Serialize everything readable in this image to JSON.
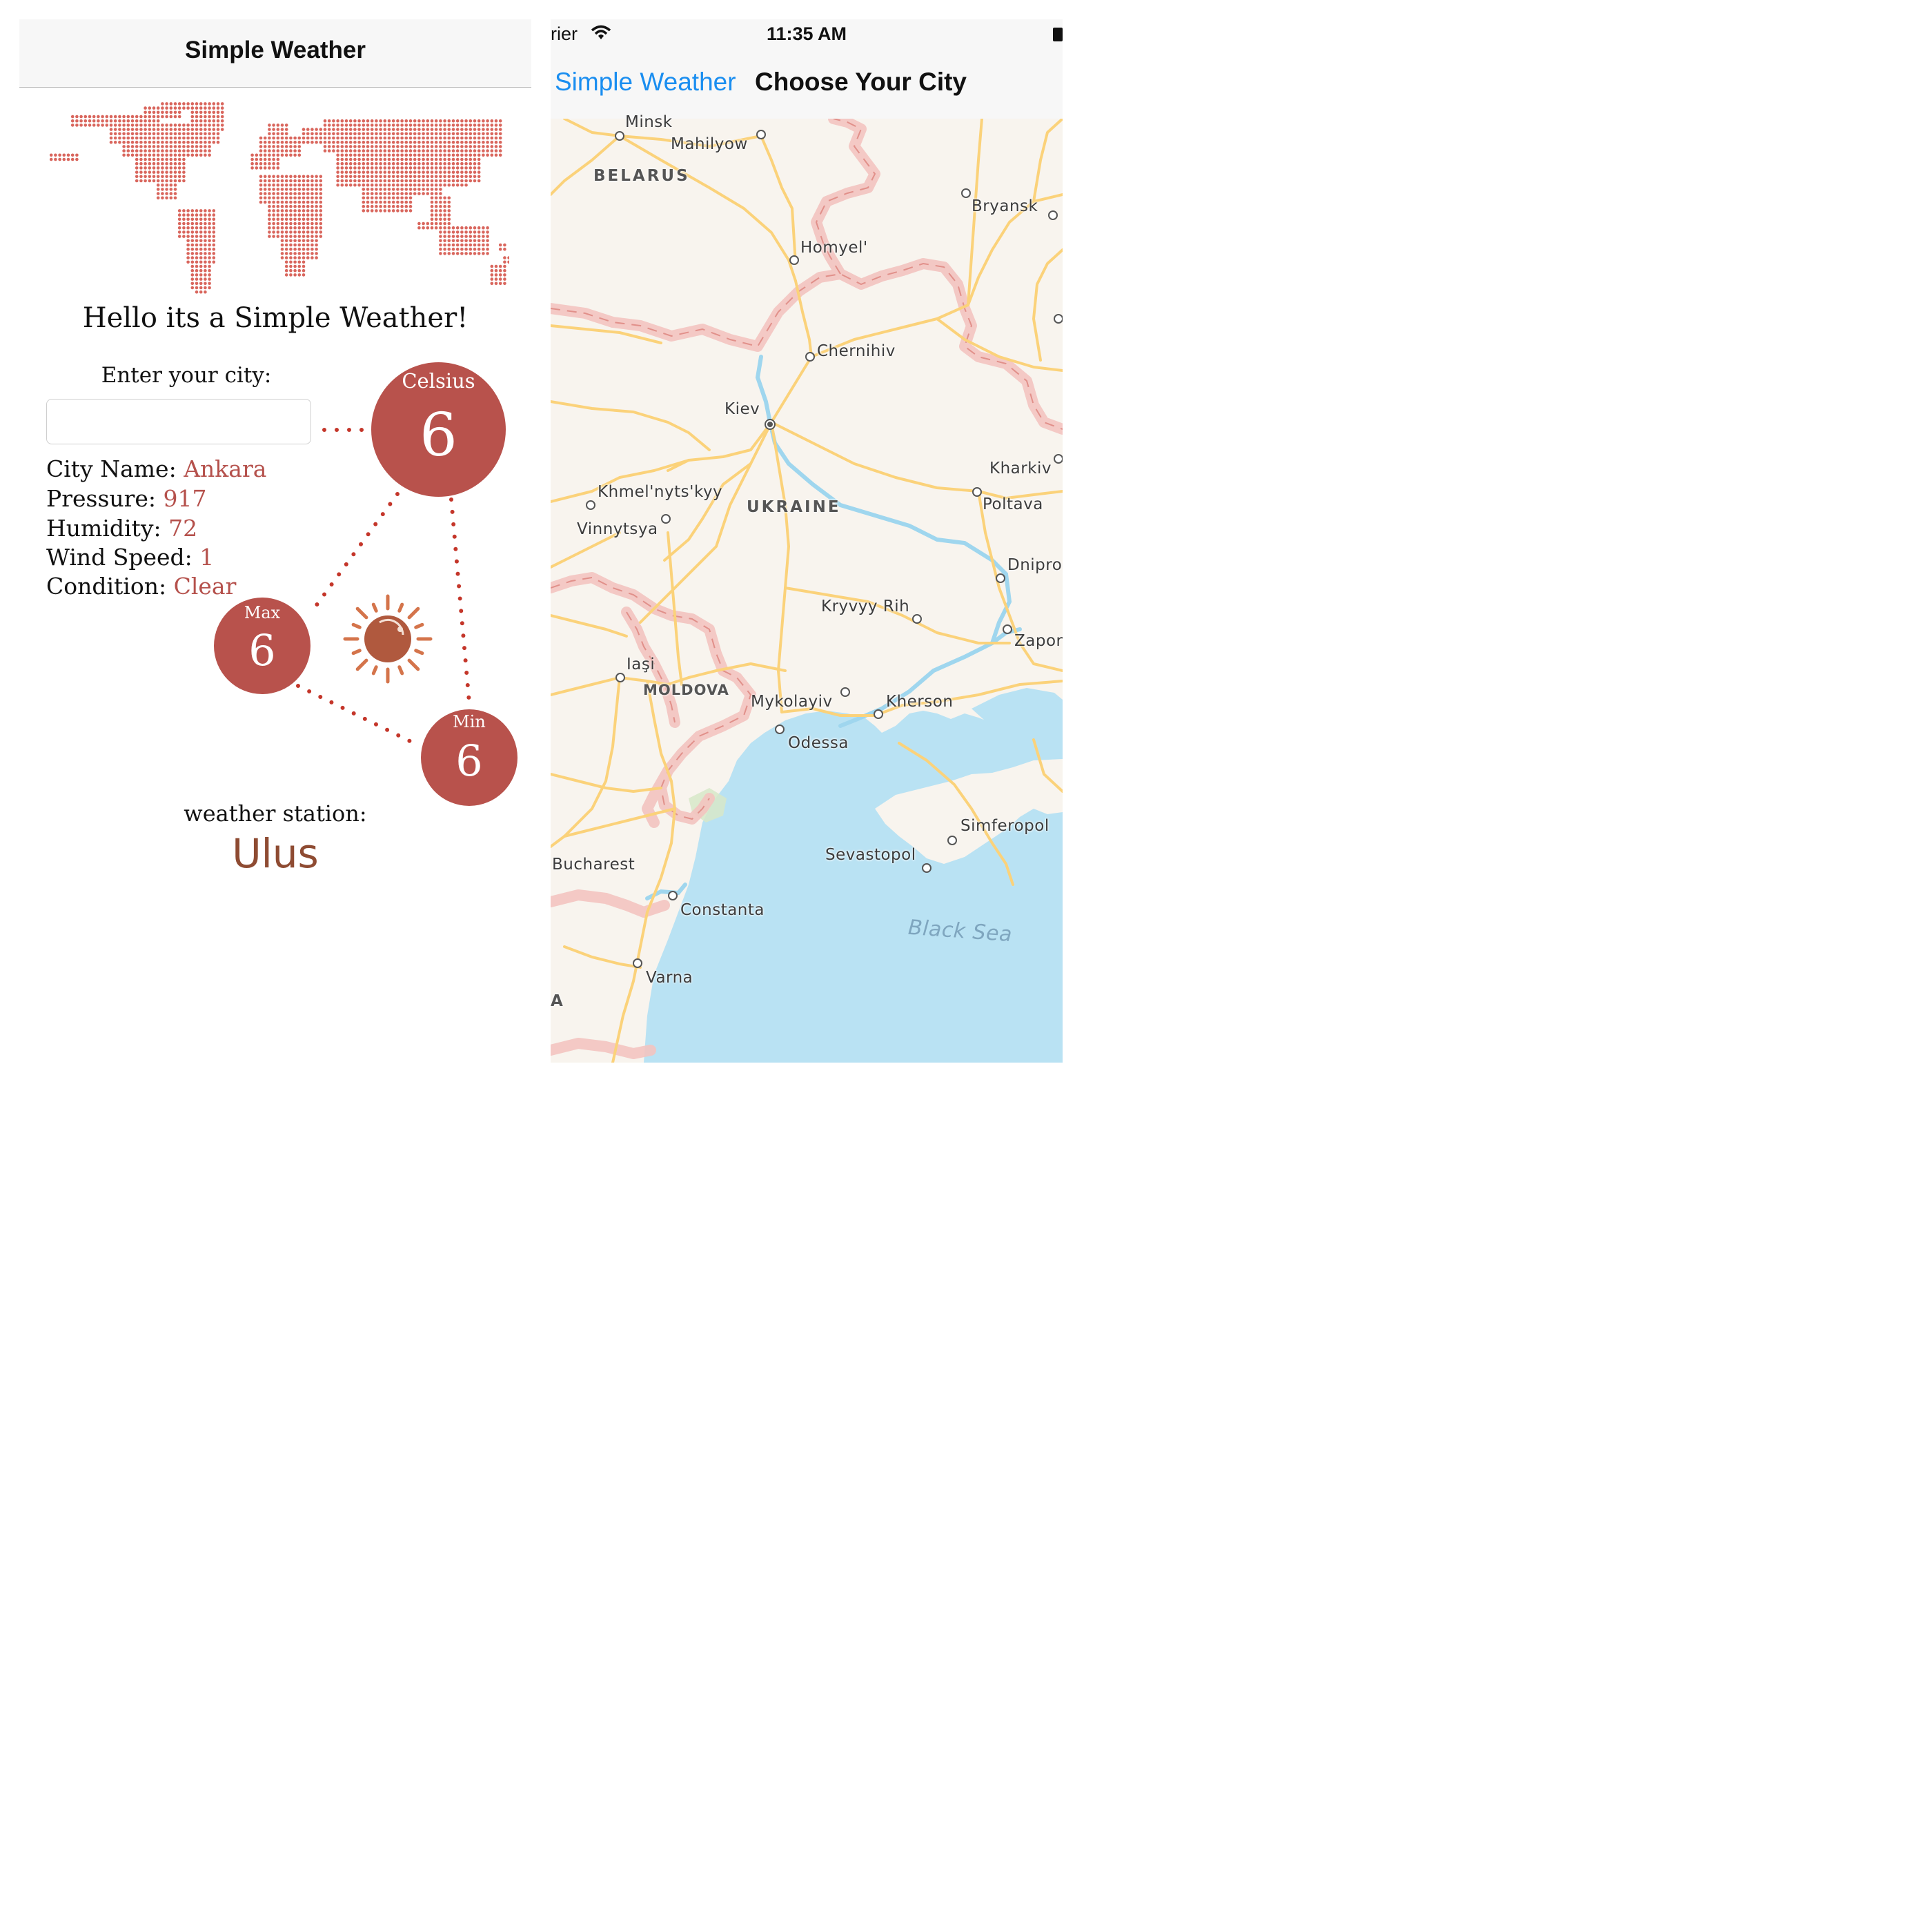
{
  "left": {
    "nav_title": "Simple Weather",
    "greeting": "Hello its a Simple Weather!",
    "enter_label": "Enter your city:",
    "city_input": {
      "value": "",
      "placeholder": ""
    },
    "info": [
      {
        "label": "City Name: ",
        "value": "Ankara"
      },
      {
        "label": "Pressure: ",
        "value": "917"
      },
      {
        "label": "Humidity: ",
        "value": "72"
      },
      {
        "label": "Wind Speed: ",
        "value": "1"
      },
      {
        "label": "Condition: ",
        "value": "Clear"
      }
    ],
    "celsius": {
      "caption": "Celsius",
      "value": "6"
    },
    "max": {
      "caption": "Max",
      "value": "6"
    },
    "min": {
      "caption": "Min",
      "value": "6"
    },
    "condition_icon": "sun-icon",
    "station_label": "weather station:",
    "station_value": "Ulus",
    "colors": {
      "accent": "#b8524c",
      "value_text": "#b5514c",
      "station": "#8e4b32"
    }
  },
  "right": {
    "status": {
      "carrier": "rier",
      "time": "11:35 AM"
    },
    "back_label": "Simple Weather",
    "nav_title": "Choose Your City",
    "map": {
      "cities": [
        "Minsk",
        "Mahilyow",
        "Bryansk",
        "Homyel'",
        "Chernihiv",
        "Kiev",
        "Kharkiv",
        "Poltava",
        "Khmel'nyts'kyy",
        "Vinnytsya",
        "Dnipro",
        "Kryvyy Rih",
        "Zapor",
        "Iaşi",
        "Mykolayiv",
        "Kherson",
        "Odessa",
        "Simferopol",
        "Sevastopol",
        "Bucharest",
        "Constanta",
        "Varna"
      ],
      "countries": [
        "BELARUS",
        "UKRAINE",
        "MOLDOVA",
        "A"
      ],
      "sea": "Black Sea",
      "colors": {
        "land": "#f8f4ee",
        "water": "#b9e2f3",
        "road": "#fbd27a",
        "border": "#f3c4c0"
      }
    }
  }
}
